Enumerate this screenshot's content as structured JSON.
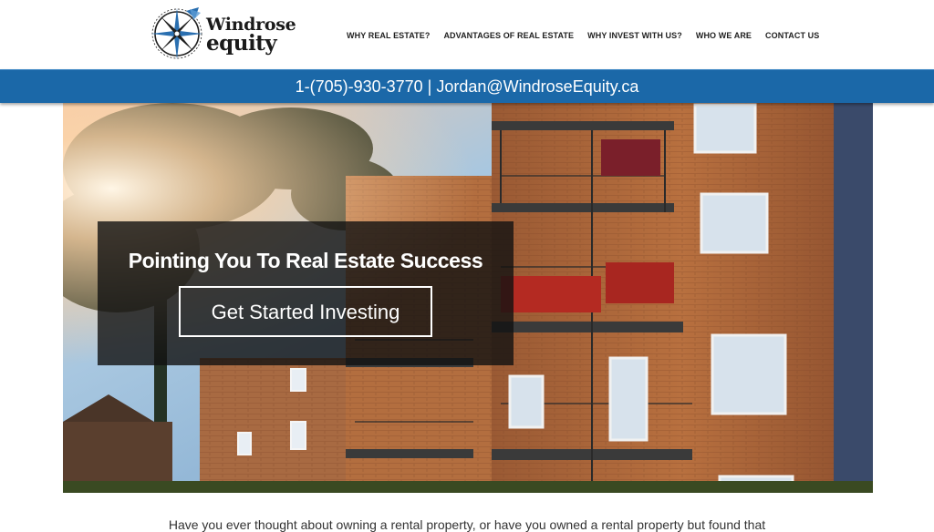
{
  "brand": {
    "name_line1": "Windrose",
    "name_line2": "equity"
  },
  "nav": {
    "items": [
      {
        "label": "WHY REAL ESTATE?"
      },
      {
        "label": "ADVANTAGES OF REAL ESTATE"
      },
      {
        "label": "WHY INVEST WITH US?"
      },
      {
        "label": "WHO WE ARE"
      },
      {
        "label": "CONTACT US"
      }
    ]
  },
  "contact": {
    "text": "1-(705)-930-3770 | Jordan@WindroseEquity.ca"
  },
  "hero": {
    "headline": "Pointing You To Real Estate Success",
    "cta_label": "Get Started Investing"
  },
  "intro": {
    "text": "Have you ever thought about owning a rental property, or have you owned a rental property but found that"
  },
  "colors": {
    "accent": "#1b68a8",
    "logo_blue": "#2a6fb0"
  }
}
